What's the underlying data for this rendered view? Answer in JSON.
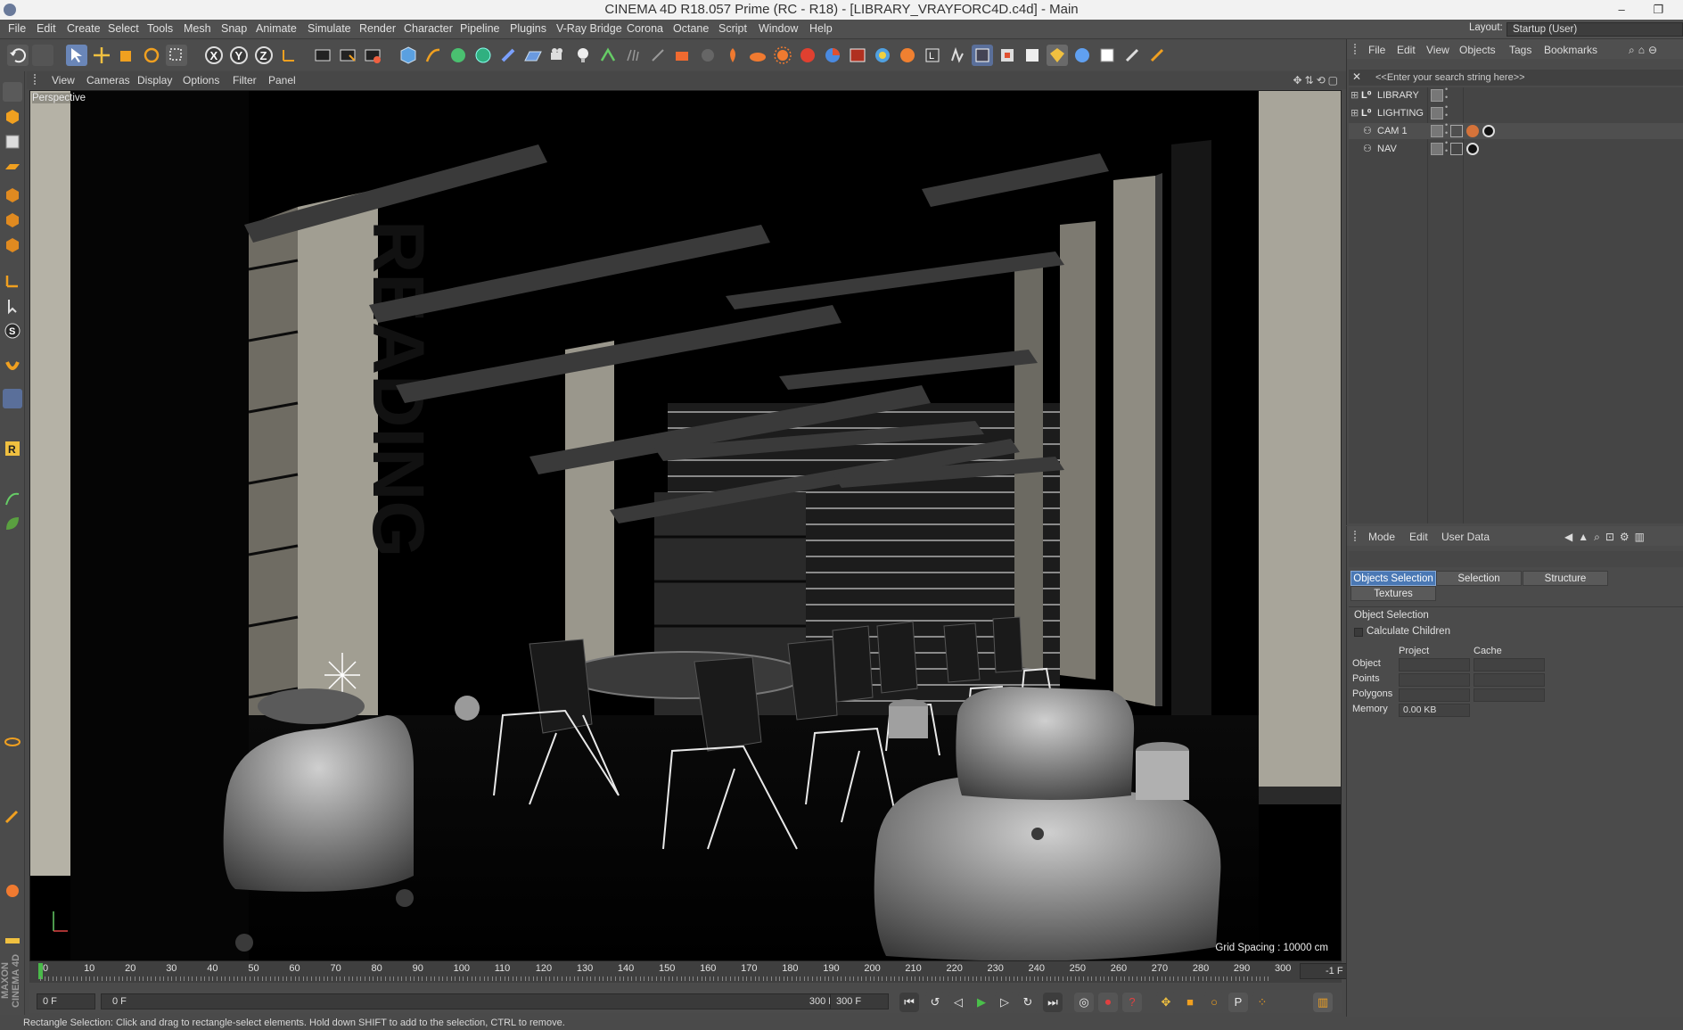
{
  "window": {
    "title": "CINEMA 4D R18.057 Prime (RC - R18) - [LIBRARY_VRAYFORC4D.c4d] - Main",
    "controls": "– ❐"
  },
  "menubar": {
    "items": [
      "File",
      "Edit",
      "Create",
      "Select",
      "Tools",
      "Mesh",
      "Snap",
      "Animate",
      "Simulate",
      "Render",
      "Character",
      "Pipeline",
      "Plugins",
      "V-Ray Bridge",
      "Corona",
      "Octane",
      "Script",
      "Window",
      "Help"
    ],
    "layout_label": "Layout:",
    "layout_value": "Startup (User)"
  },
  "viewport": {
    "menu": [
      "View",
      "Cameras",
      "Display",
      "Options",
      "Filter",
      "Panel"
    ],
    "label": "Perspective",
    "grid_spacing": "Grid Spacing : 10000 cm",
    "scene_text": "READING"
  },
  "timeline": {
    "ticks": [
      "0",
      "10",
      "20",
      "30",
      "40",
      "50",
      "60",
      "70",
      "80",
      "90",
      "100",
      "110",
      "120",
      "130",
      "140",
      "150",
      "160",
      "170",
      "180",
      "190",
      "200",
      "210",
      "220",
      "230",
      "240",
      "250",
      "260",
      "270",
      "280",
      "290",
      "300"
    ],
    "current_frame_field": "-1 F"
  },
  "transport": {
    "start_field": "0 F",
    "range_left": "0 F",
    "range_right": "300 F",
    "end_field": "300 F"
  },
  "statusbar": {
    "text": "Rectangle Selection: Click and drag to rectangle-select elements. Hold down SHIFT to add to the selection, CTRL to remove."
  },
  "objects": {
    "menu": [
      "File",
      "Edit",
      "View",
      "Objects",
      "Tags",
      "Bookmarks"
    ],
    "search_placeholder": "<<Enter your search string here>>",
    "items": [
      {
        "name": "LIBRARY"
      },
      {
        "name": "LIGHTING"
      },
      {
        "name": "CAM 1"
      },
      {
        "name": "NAV"
      }
    ]
  },
  "attributes": {
    "menu": [
      "Mode",
      "Edit",
      "User Data"
    ],
    "tabs": [
      "Objects Selection",
      "Selection",
      "Structure",
      "Textures"
    ],
    "section": "Object Selection",
    "checkbox_label": "Calculate Children",
    "columns": [
      "Project",
      "Cache"
    ],
    "rows": [
      {
        "label": "Object",
        "project": "",
        "cache": ""
      },
      {
        "label": "Points",
        "project": "",
        "cache": ""
      },
      {
        "label": "Polygons",
        "project": "",
        "cache": ""
      },
      {
        "label": "Memory",
        "project": "0.00 KB",
        "cache": ""
      }
    ]
  },
  "colors": {
    "accent": "#4a78b4",
    "ui_bg": "#4b4b4b",
    "viewport_bg": "#000000"
  }
}
